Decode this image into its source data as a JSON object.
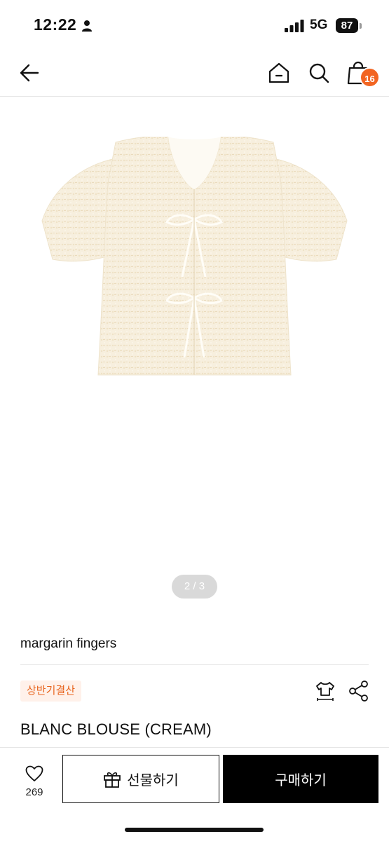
{
  "status_bar": {
    "time": "12:22",
    "network": "5G",
    "battery": "87"
  },
  "nav": {
    "cart_count": "16",
    "icons": [
      "back-arrow-icon",
      "home-icon",
      "search-icon",
      "shopping-bag-icon"
    ]
  },
  "product": {
    "image_pager": "2 / 3",
    "brand": "margarin fingers",
    "promo_badge": "상반기결산",
    "title": "BLANC BLOUSE (CREAM)"
  },
  "actions": {
    "like_count": "269",
    "gift_label": "선물하기",
    "buy_label": "구매하기"
  },
  "colors": {
    "accent_orange": "#f26522",
    "badge_text": "#e8641d",
    "badge_bg": "#fff1ea",
    "buy_bg": "#000000"
  }
}
